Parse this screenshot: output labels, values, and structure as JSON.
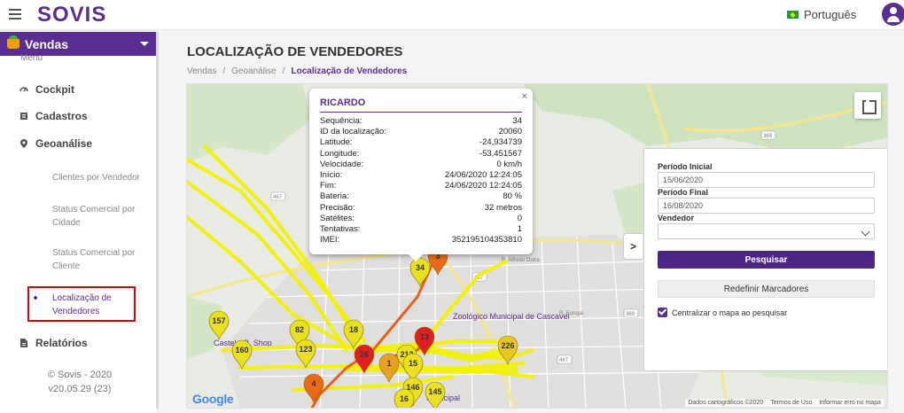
{
  "header": {
    "logo": "SOVIS",
    "language": "Português"
  },
  "sidebar": {
    "module": "Vendas",
    "menu_label": "Menu",
    "items": [
      {
        "label": "Cockpit"
      },
      {
        "label": "Cadastros"
      },
      {
        "label": "Geoanálise"
      },
      {
        "label": "Relatórios"
      }
    ],
    "geo_subitems": [
      {
        "label": "Clientes por Vendedor"
      },
      {
        "label": "Status Comercial por Cidade"
      },
      {
        "label": "Status Comercial por Cliente"
      },
      {
        "label": "Localização de Vendedores"
      }
    ],
    "footer_copyright": "© Sovis - 2020",
    "footer_version": "v20.05.29 (23)"
  },
  "page": {
    "title": "LOCALIZAÇÃO DE VENDEDORES",
    "breadcrumb": [
      "Vendas",
      "Geoanálise",
      "Localização de Vendedores"
    ]
  },
  "popup": {
    "title": "RICARDO",
    "close": "×",
    "rows": [
      {
        "label": "Sequência:",
        "value": "34"
      },
      {
        "label": "ID da localização:",
        "value": "20060"
      },
      {
        "label": "Latitude:",
        "value": "-24,934739"
      },
      {
        "label": "Longitude:",
        "value": "-53,451567"
      },
      {
        "label": "Velocidade:",
        "value": "0 km/h"
      },
      {
        "label": "Início:",
        "value": "24/06/2020 12:24:05"
      },
      {
        "label": "Fim:",
        "value": "24/06/2020 12:24:05"
      },
      {
        "label": "Bateria:",
        "value": "80 %"
      },
      {
        "label": "Precisão:",
        "value": "32 metros"
      },
      {
        "label": "Satélites:",
        "value": "0"
      },
      {
        "label": "Tentativas:",
        "value": "1"
      },
      {
        "label": "IMEI:",
        "value": "352195104353810"
      }
    ]
  },
  "search_panel": {
    "start_label": "Período Inicial",
    "start_value": "15/06/2020",
    "end_label": "Período Final",
    "end_value": "16/08/2020",
    "seller_label": "Vendedor",
    "seller_value": "",
    "search_button": "Pesquisar",
    "reset_button": "Redefinir Marcadores",
    "center_checkbox_label": "Centralizar o mapa ao pesquisar",
    "center_checked": true
  },
  "map": {
    "google": "Google",
    "attribution": [
      "Dados cartográficos ©2020",
      "Termos de Uso",
      "Informar erro no mapa"
    ],
    "road_labels": [
      "467",
      "467",
      "369",
      "369",
      "467",
      "467",
      "369"
    ],
    "places": [
      "Zoológico Municipal de Cascavel",
      "Castelo JL Shop",
      "R. Alfredo Dutra",
      "R. Europa",
      "Municipal"
    ],
    "markers": [
      {
        "label": "157",
        "color": "#e8e020"
      },
      {
        "label": "160",
        "color": "#e8e020"
      },
      {
        "label": "82",
        "color": "#e8e020"
      },
      {
        "label": "123",
        "color": "#e8e020"
      },
      {
        "label": "18",
        "color": "#e8e020"
      },
      {
        "label": "34",
        "color": "#e8e020"
      },
      {
        "label": "3",
        "color": "#e86a1a"
      },
      {
        "label": "13",
        "color": "#e02020"
      },
      {
        "label": "26",
        "color": "#e02020"
      },
      {
        "label": "212",
        "color": "#e8e020"
      },
      {
        "label": "1",
        "color": "#e8a020"
      },
      {
        "label": "15",
        "color": "#e8e020"
      },
      {
        "label": "226",
        "color": "#e8c820"
      },
      {
        "label": "4",
        "color": "#e86a1a"
      },
      {
        "label": "146",
        "color": "#e8e020"
      },
      {
        "label": "145",
        "color": "#e8e020"
      },
      {
        "label": "16",
        "color": "#e8e020"
      }
    ]
  }
}
